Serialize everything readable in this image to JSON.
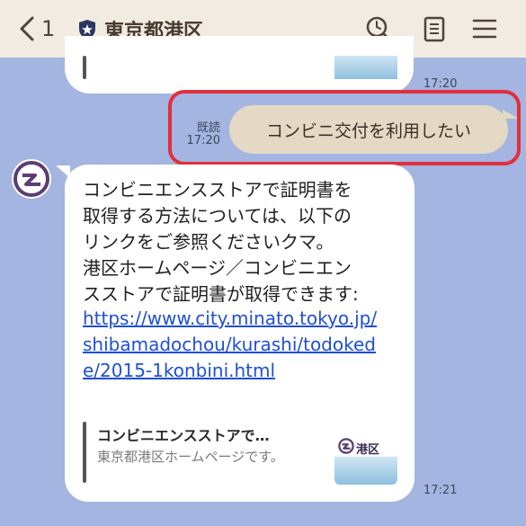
{
  "header": {
    "back_count": "1",
    "title": "東京都港区"
  },
  "top_message": {
    "time": "17:20"
  },
  "outgoing": {
    "read_label": "既読",
    "time": "17:20",
    "text": "コンビニ交付を利用したい"
  },
  "reply": {
    "text": "コンビニエンスストアで証明書を\n取得する方法については、以下の\nリンクをご参照くださいクマ。\n港区ホームページ／コンビニエン\nスストアで証明書が取得できます:",
    "link": "https://www.city.minato.tokyo.jp/shibamadochou/kurashi/todokede/2015-1konbini.html",
    "preview_title": "コンビニエンスストアで…",
    "preview_subtitle": "東京都港区ホームページです。",
    "preview_thumb_label": "港区",
    "time": "17:21"
  },
  "colors": {
    "background": "#a3b5e0",
    "header": "#f1ebe1",
    "outgoing_bubble": "#e4d9c4",
    "highlight": "#e42e3c",
    "link": "#1f4fd6"
  },
  "icons": [
    "back-chevron-icon",
    "official-shield-icon",
    "search-icon",
    "notes-icon",
    "menu-icon",
    "minato-ward-logo-icon"
  ]
}
